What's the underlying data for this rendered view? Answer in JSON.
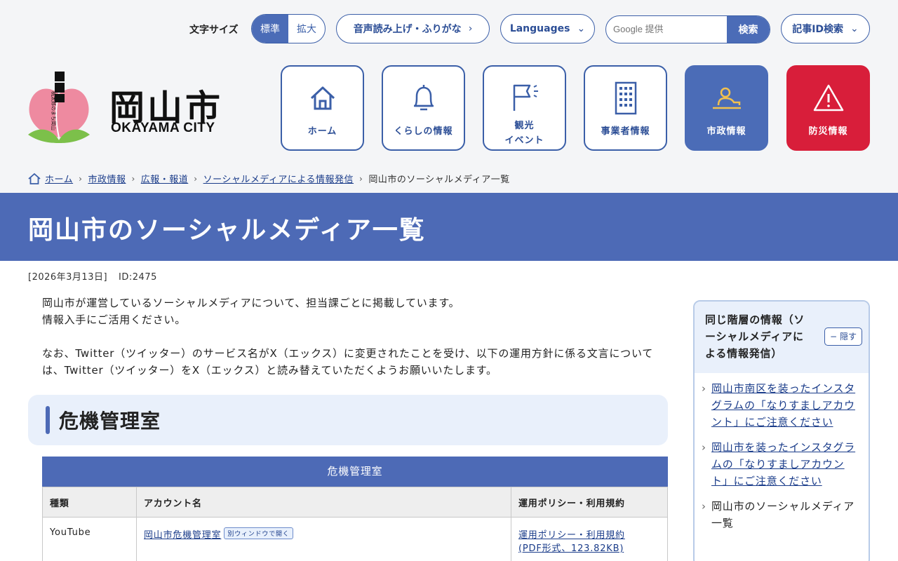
{
  "utility": {
    "font_size_label": "文字サイズ",
    "font_standard": "標準",
    "font_enlarge": "拡大",
    "read_aloud": "音声読み上げ・ふりがな",
    "languages": "Languages",
    "search_placeholder": "Google 提供",
    "search_button": "検索",
    "article_id_search": "記事ID検索"
  },
  "logo": {
    "title": "岡山市",
    "subtitle": "OKAYAMA CITY",
    "mascot_text": "桃太郎のまち岡山"
  },
  "nav": [
    {
      "label": "ホーム",
      "icon": "home-icon"
    },
    {
      "label": "くらしの情報",
      "icon": "bell-icon"
    },
    {
      "label": "観光\nイベント",
      "icon": "flag-icon"
    },
    {
      "label": "事業者情報",
      "icon": "building-icon"
    },
    {
      "label": "市政情報",
      "icon": "city-hall-icon"
    },
    {
      "label": "防災情報",
      "icon": "warning-icon"
    }
  ],
  "breadcrumb": {
    "items": [
      "ホーム",
      "市政情報",
      "広報・報道",
      "ソーシャルメディアによる情報発信"
    ],
    "current": "岡山市のソーシャルメディア一覧"
  },
  "page": {
    "title": "岡山市のソーシャルメディア一覧",
    "date": "[2026年3月13日]",
    "id": "ID:2475",
    "intro1": "岡山市が運営しているソーシャルメディアについて、担当課ごとに掲載しています。\n情報入手にご活用ください。",
    "intro2": "なお、Twitter（ツイッター）のサービス名がX（エックス）に変更されたことを受け、以下の運用方針に係る文言については、Twitter（ツイッター）をX（エックス）と読み替えていただくようお願いいたします。",
    "section_heading": "危機管理室"
  },
  "table": {
    "caption": "危機管理室",
    "headers": [
      "種類",
      "アカウント名",
      "運用ポリシー・利用規約"
    ],
    "rows": [
      {
        "type": "YouTube",
        "account": "岡山市危機管理室",
        "new_window": "別ウィンドウで開く",
        "policy": "運用ポリシー・利用規約\n(PDF形式、123.82KB)"
      }
    ]
  },
  "sidebar": {
    "heading": "同じ階層の情報（ソーシャルメディアによる情報発信）",
    "hide_button": "隠す",
    "items": [
      {
        "label": "岡山市南区を装ったインスタグラムの「なりすましアカウント」にご注意ください",
        "link": true
      },
      {
        "label": "岡山市を装ったインスタグラムの「なりすましアカウント」にご注意ください",
        "link": true
      },
      {
        "label": "岡山市のソーシャルメディア一覧",
        "link": false
      }
    ]
  },
  "colors": {
    "primary": "#4d6ab6",
    "border": "#3b5fa8",
    "danger": "#d81e3a",
    "link": "#1a3c8a"
  }
}
